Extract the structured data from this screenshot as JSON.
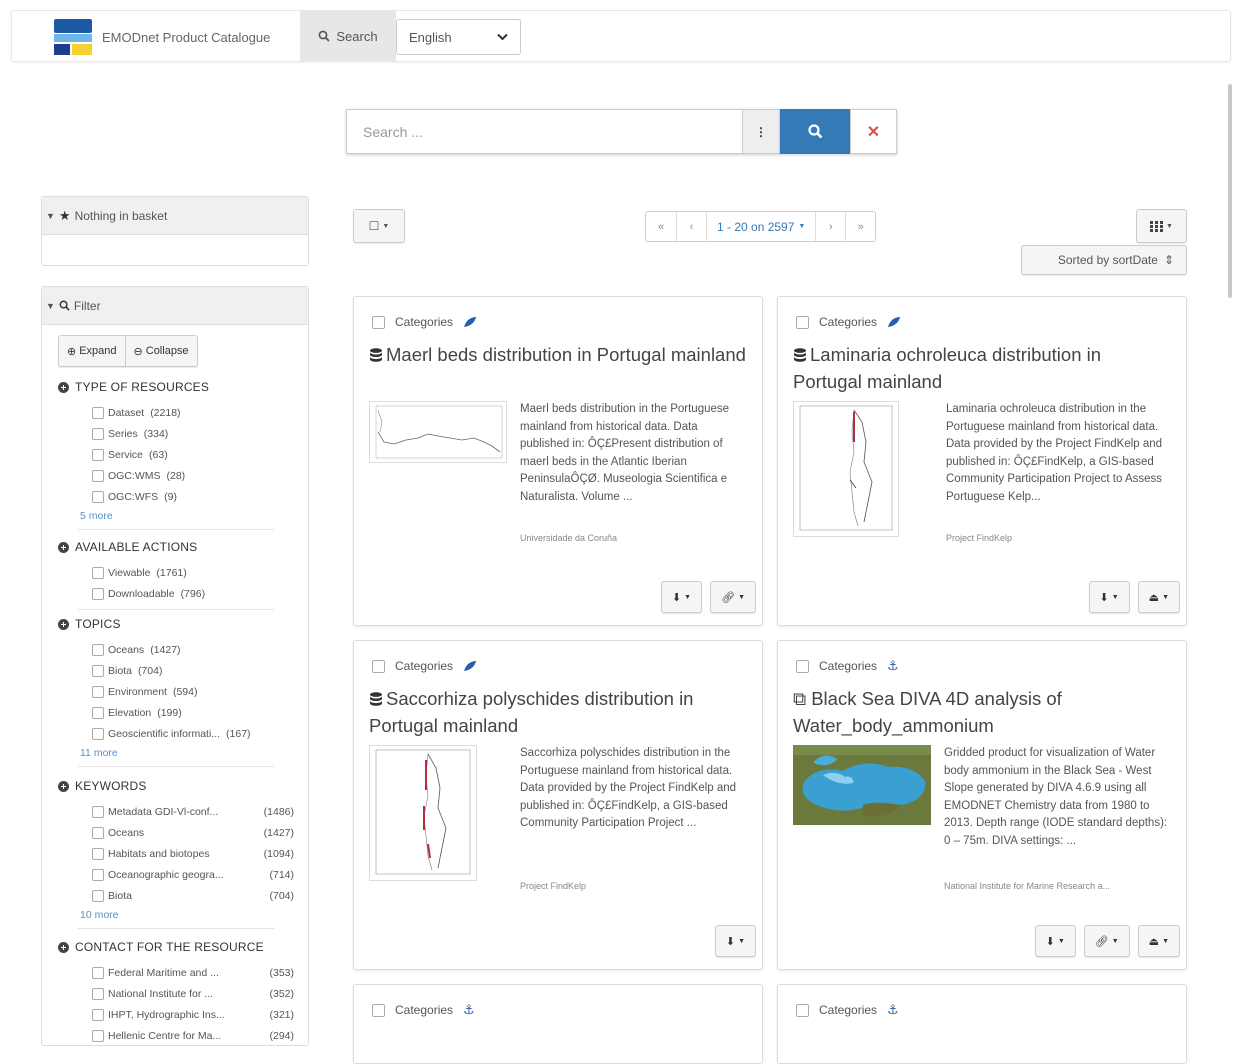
{
  "navbar": {
    "brand_name": "EMODnet Product Catalogue",
    "logo_text": "EMODnet",
    "search_tab": "Search",
    "language": "English"
  },
  "search": {
    "placeholder": "Search ...",
    "options_glyph": "⋮",
    "clear_glyph": "✕"
  },
  "basket": {
    "label": "Nothing in basket"
  },
  "filter": {
    "label": "Filter",
    "expand": "Expand",
    "collapse": "Collapse",
    "facets": [
      {
        "title": "TYPE OF RESOURCES",
        "items": [
          {
            "label": "Dataset",
            "count": "(2218)"
          },
          {
            "label": "Series",
            "count": "(334)"
          },
          {
            "label": "Service",
            "count": "(63)"
          },
          {
            "label": "OGC:WMS",
            "count": "(28)"
          },
          {
            "label": "OGC:WFS",
            "count": "(9)"
          }
        ],
        "more": "5 more"
      },
      {
        "title": "AVAILABLE ACTIONS",
        "items": [
          {
            "label": "Viewable",
            "count": "(1761)"
          },
          {
            "label": "Downloadable",
            "count": "(796)"
          }
        ]
      },
      {
        "title": "TOPICS",
        "items": [
          {
            "label": "Oceans",
            "count": "(1427)"
          },
          {
            "label": "Biota",
            "count": "(704)"
          },
          {
            "label": "Environment",
            "count": "(594)"
          },
          {
            "label": "Elevation",
            "count": "(199)"
          },
          {
            "label": "Geoscientific informati...",
            "count": "(167)"
          }
        ],
        "more": "11 more"
      },
      {
        "title": "KEYWORDS",
        "items": [
          {
            "label": "Metadata GDI-Vl-conf...",
            "count": "(1486)"
          },
          {
            "label": "Oceans",
            "count": "(1427)"
          },
          {
            "label": "Habitats and biotopes",
            "count": "(1094)"
          },
          {
            "label": "Oceanographic geogra...",
            "count": "(714)"
          },
          {
            "label": "Biota",
            "count": "(704)"
          }
        ],
        "more": "10 more"
      },
      {
        "title": "CONTACT FOR THE RESOURCE",
        "items": [
          {
            "label": "Federal Maritime and ...",
            "count": "(353)"
          },
          {
            "label": "National Institute for ...",
            "count": "(352)"
          },
          {
            "label": "IHPT, Hydrographic Ins...",
            "count": "(321)"
          },
          {
            "label": "Hellenic Centre for Ma...",
            "count": "(294)"
          }
        ]
      }
    ]
  },
  "toolbar": {
    "select_glyph": "☐",
    "pager": {
      "first": "«",
      "prev": "‹",
      "range": "1 - 20 on 2597",
      "next": "›",
      "last": "»"
    },
    "sort_label": "Sorted by sortDate",
    "sort_glyph": "⇕"
  },
  "cards": [
    {
      "category": "Categories",
      "title": "Maerl beds distribution in Portugal mainland",
      "description": "Maerl beds distribution in the Portuguese mainland from historical data. Data published in: ÔÇ£Present distribution of maerl beds in the Atlantic Iberian PeninsulaÔÇØ. Museologia Scientifica e Naturalista. Volume ...",
      "org": "Universidade da Coruña"
    },
    {
      "category": "Categories",
      "title": "Laminaria ochroleuca distribution in Portugal mainland",
      "description": "Laminaria ochroleuca distribution in the Portuguese mainland from historical data. Data provided by the Project FindKelp and published in: ÔÇ£FindKelp, a GIS-based Community Participation Project to Assess Portuguese Kelp...",
      "org": "Project FindKelp"
    },
    {
      "category": "Categories",
      "title": "Saccorhiza polyschides distribution in Portugal mainland",
      "description": "Saccorhiza polyschides distribution in the Portuguese mainland from historical data. Data provided by the Project FindKelp and published in: ÔÇ£FindKelp, a GIS-based Community Participation Project ...",
      "org": "Project FindKelp"
    },
    {
      "category": "Categories",
      "title": "Black Sea DIVA 4D analysis of Water_body_ammonium",
      "description": "Gridded product for visualization of Water body ammonium in the Black Sea - West Slope generated by DIVA 4.6.9 using all EMODNET Chemistry data from 1980 to 2013. Depth range (IODE standard depths): 0 – 75m. DIVA settings: ...",
      "org": "National Institute for Marine Research a..."
    },
    {
      "category": "Categories"
    },
    {
      "category": "Categories"
    }
  ],
  "colors": {
    "primary": "#337ab7",
    "danger": "#d9534f",
    "navy": "#1d3f73"
  }
}
